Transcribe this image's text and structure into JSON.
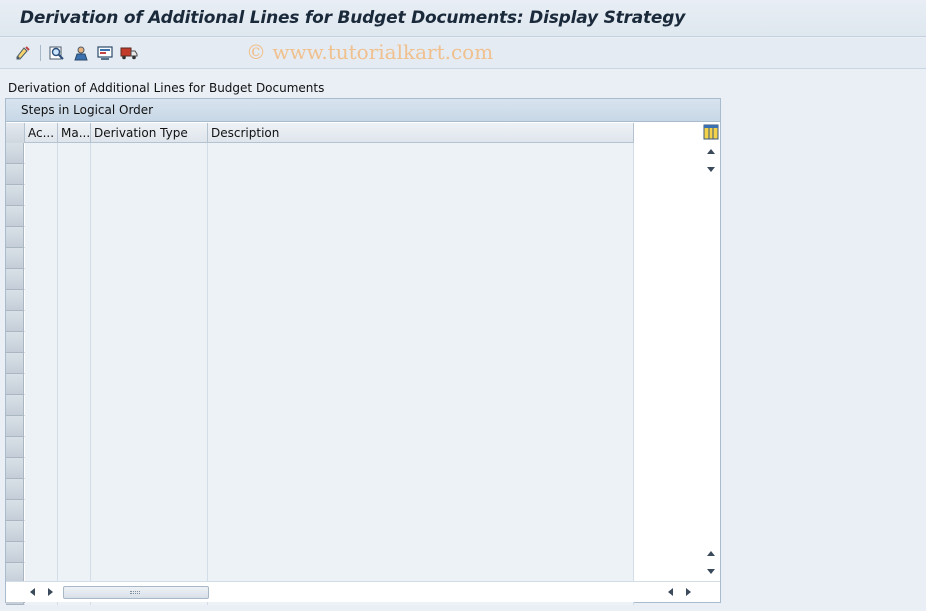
{
  "window": {
    "title": "Derivation of Additional Lines for Budget Documents: Display Strategy"
  },
  "toolbar": {
    "icons": [
      "edit-pencil-icon",
      "find-icon",
      "person-icon",
      "display-icon",
      "transport-truck-icon"
    ],
    "watermark": "© www.tutorialkart.com"
  },
  "section": {
    "label": "Derivation of Additional Lines for Budget Documents"
  },
  "table": {
    "caption": "Steps in Logical Order",
    "columns": [
      {
        "key": "active",
        "label": "Ac..."
      },
      {
        "key": "mandatory",
        "label": "Ma..."
      },
      {
        "key": "derivation_type",
        "label": "Derivation Type"
      },
      {
        "key": "description",
        "label": "Description"
      }
    ],
    "rows": [
      [
        "",
        "",
        "",
        ""
      ],
      [
        "",
        "",
        "",
        ""
      ],
      [
        "",
        "",
        "",
        ""
      ],
      [
        "",
        "",
        "",
        ""
      ],
      [
        "",
        "",
        "",
        ""
      ],
      [
        "",
        "",
        "",
        ""
      ],
      [
        "",
        "",
        "",
        ""
      ],
      [
        "",
        "",
        "",
        ""
      ],
      [
        "",
        "",
        "",
        ""
      ],
      [
        "",
        "",
        "",
        ""
      ],
      [
        "",
        "",
        "",
        ""
      ],
      [
        "",
        "",
        "",
        ""
      ],
      [
        "",
        "",
        "",
        ""
      ],
      [
        "",
        "",
        "",
        ""
      ],
      [
        "",
        "",
        "",
        ""
      ],
      [
        "",
        "",
        "",
        ""
      ],
      [
        "",
        "",
        "",
        ""
      ],
      [
        "",
        "",
        "",
        ""
      ],
      [
        "",
        "",
        "",
        ""
      ],
      [
        "",
        "",
        "",
        ""
      ],
      [
        "",
        "",
        "",
        ""
      ],
      [
        "",
        "",
        "",
        ""
      ]
    ]
  },
  "colors": {
    "accent": "#1b2a3b",
    "watermark": "#f0c08e",
    "cell": "#edf2f7"
  }
}
